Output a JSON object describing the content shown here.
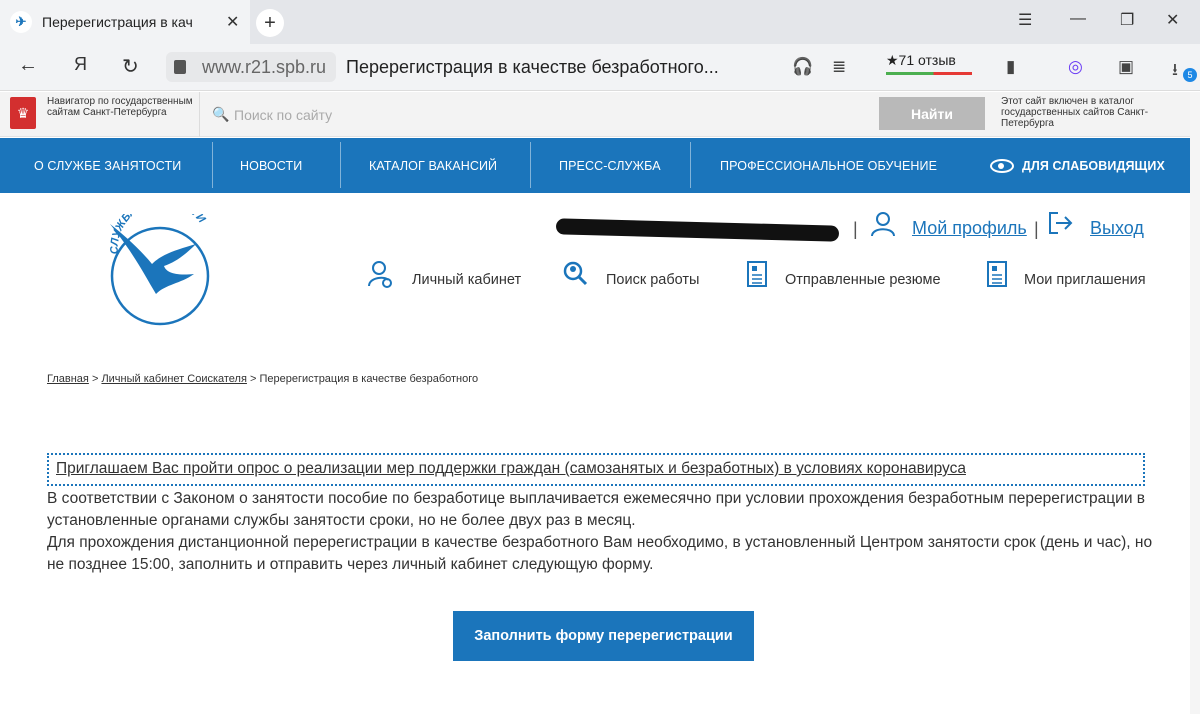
{
  "browser": {
    "tab_title": "Перерегистрация в кач",
    "url_domain": "www.r21.spb.ru",
    "page_title": "Перерегистрация в качестве безработного...",
    "rating": "★71 отзыв",
    "download_count": "5",
    "icons": [
      "back-icon",
      "yandex-icon",
      "reload-icon",
      "lock-icon",
      "headphones-icon",
      "reader-icon",
      "bookmark-icon",
      "alice-icon",
      "collections-icon",
      "download-icon"
    ]
  },
  "gov": {
    "navigator": "Навигатор по государственным сайтам Санкт-Петербурга",
    "search_placeholder": "Поиск по сайту",
    "find_label": "Найти",
    "note": "Этот сайт включен в каталог государственных сайтов Санкт-Петербурга"
  },
  "menu": {
    "items": [
      "О СЛУЖБЕ ЗАНЯТОСТИ",
      "НОВОСТИ",
      "КАТАЛОГ ВАКАНСИЙ",
      "ПРЕСС-СЛУЖБА",
      "ПРОФЕССИОНАЛЬНОЕ ОБУЧЕНИЕ"
    ],
    "vision": "ДЛЯ СЛАБОВИДЯЩИХ"
  },
  "header": {
    "logo_text": "СЛУЖБА ЗАНЯТОСТИ",
    "profile": "Мой профиль",
    "logout": "Выход",
    "pipe": "|",
    "links": [
      "Личный кабинет",
      "Поиск работы",
      "Отправленные резюме",
      "Мои приглашения"
    ]
  },
  "breadcrumb": {
    "home": "Главная",
    "cabinet": "Личный кабинет Соискателя",
    "current": "Перерегистрация в качестве безработного",
    "sep": ">"
  },
  "content": {
    "survey_link": "Приглашаем Вас пройти опрос о реализации мер поддержки граждан (самозанятых и безработных) в условиях коронавируса",
    "paragraph_1": "В соответствии с Законом о занятости пособие по безработице выплачивается ежемесячно при условии прохождения безработным перерегистрации в установленные органами службы занятости сроки, но не более двух раз в месяц.",
    "paragraph_2": "Для прохождения дистанционной перерегистрации в качестве безработного Вам необходимо, в установленный Центром занятости срок (день и час), но не позднее 15:00, заполнить и отправить через личный кабинет следующую форму.",
    "cta": "Заполнить форму перерегистрации"
  },
  "colors": {
    "brand_blue": "#1b75bb",
    "find_button": "#b9b9b9"
  }
}
